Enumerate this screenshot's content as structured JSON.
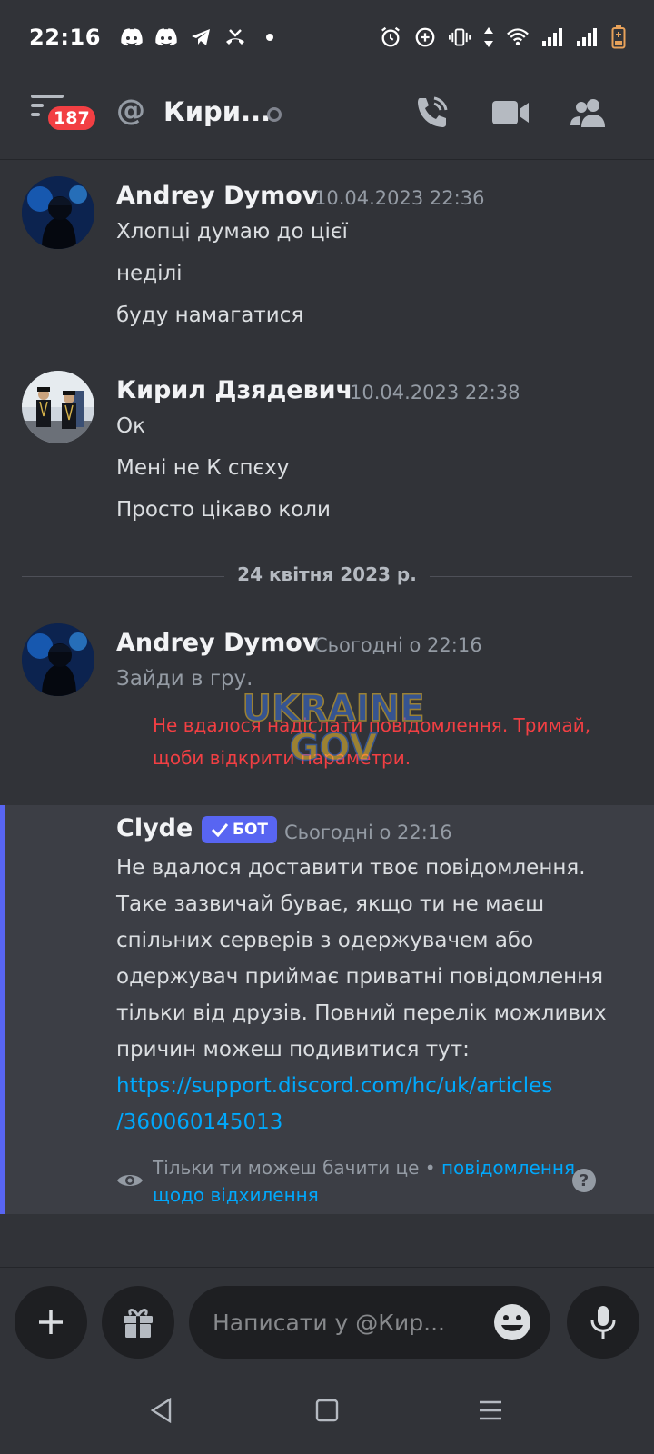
{
  "status_bar": {
    "time": "22:16",
    "left_icons": [
      "discord-icon",
      "discord-icon",
      "telegram-icon",
      "missed-call-icon",
      "dot-icon"
    ],
    "right_icons": [
      "alarm-icon",
      "data-saver-icon",
      "vibrate-icon",
      "data-arrows-icon",
      "wifi-icon",
      "signal-icon",
      "signal-icon",
      "battery-icon"
    ]
  },
  "header": {
    "badge_count": "187",
    "at_symbol": "@",
    "channel_name": "Кири...",
    "icons": [
      "menu-icon",
      "call-icon",
      "video-icon",
      "members-icon"
    ]
  },
  "messages": [
    {
      "author": "Andrey Dymov",
      "timestamp": "10.04.2023 22:36",
      "lines": [
        "Хлопці думаю до цієї",
        "неділі",
        "буду намагатися"
      ]
    },
    {
      "author": "Кирил Дзядевич",
      "timestamp": "10.04.2023 22:38",
      "lines": [
        "Ок",
        "Мені не К спєху",
        "Просто цікаво коли"
      ]
    }
  ],
  "date_divider": "24 квітня 2023 р.",
  "failed_message": {
    "author": "Andrey Dymov",
    "timestamp": "Сьогодні о 22:16",
    "text": "Зайди в гру.",
    "error_lines": [
      "Не вдалося надіслати повідомлення. Тримай,",
      "щоби відкрити параметри."
    ]
  },
  "clyde": {
    "author": "Clyde",
    "bot_label": "БОТ",
    "timestamp": "Сьогодні о 22:16",
    "lines": [
      "Не вдалося доставити твоє повідомлення.",
      "Таке зазвичай буває, якщо ти не маєш",
      "спільних серверів з одержувачем або",
      "одержувач приймає приватні повідомлення",
      "тільки від друзів. Повний перелік можливих",
      "причин можеш подивитися тут:"
    ],
    "link_lines": [
      "https://support.discord.com/hc/uk/articles",
      "/360060145013"
    ],
    "ephemeral_text": "Тільки ти можеш бачити це •",
    "ephemeral_link": "повідомлення щодо відхилення"
  },
  "watermark": {
    "line1": "UKRAINE",
    "line2": "GOV"
  },
  "composer": {
    "placeholder": "Написати у @Кир..."
  },
  "colors": {
    "background": "#313338",
    "accent": "#5865f2",
    "error": "#f23f43",
    "link": "#00a8fc"
  }
}
